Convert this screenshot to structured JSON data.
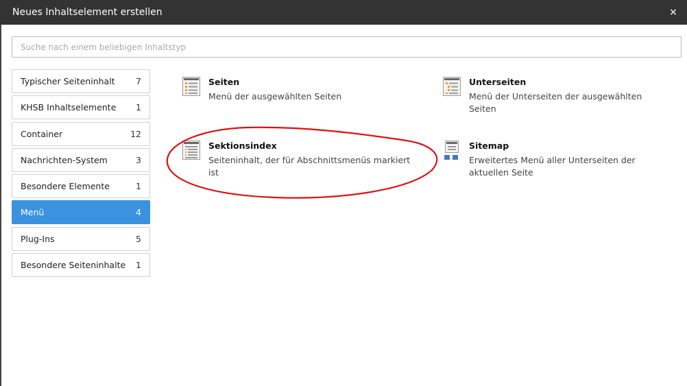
{
  "dialog": {
    "title": "Neues Inhaltselement erstellen",
    "close_label": "×"
  },
  "search": {
    "placeholder": "Suche nach einem beliebigen Inhaltstyp",
    "value": ""
  },
  "categories": [
    {
      "label": "Typischer Seiteninhalt",
      "count": "7"
    },
    {
      "label": "KHSB Inhaltselemente",
      "count": "1"
    },
    {
      "label": "Container",
      "count": "12"
    },
    {
      "label": "Nachrichten-System",
      "count": "3"
    },
    {
      "label": "Besondere Elemente",
      "count": "1"
    },
    {
      "label": "Menü",
      "count": "4",
      "active": true
    },
    {
      "label": "Plug-Ins",
      "count": "5"
    },
    {
      "label": "Besondere Seiteninhalte",
      "count": "1"
    }
  ],
  "items": [
    {
      "name": "Seiten",
      "description": "Menü der ausgewählten Seiten",
      "icon": "menu-pages-icon"
    },
    {
      "name": "Unterseiten",
      "description": "Menü der Unterseiten der ausgewählten Seiten",
      "icon": "menu-subpages-icon"
    },
    {
      "name": "Sektionsindex",
      "description": "Seiteninhalt, der für Abschnittsmenüs markiert ist",
      "icon": "section-index-icon"
    },
    {
      "name": "Sitemap",
      "description": "Erweitertes Menü aller Unterseiten der aktuellen Seite",
      "icon": "sitemap-icon"
    }
  ],
  "colors": {
    "titlebar": "#333333",
    "active_tab": "#3a92e0",
    "annotation": "#e01010",
    "icon_orange": "#f29a2e",
    "icon_blue": "#3d7bc9"
  }
}
